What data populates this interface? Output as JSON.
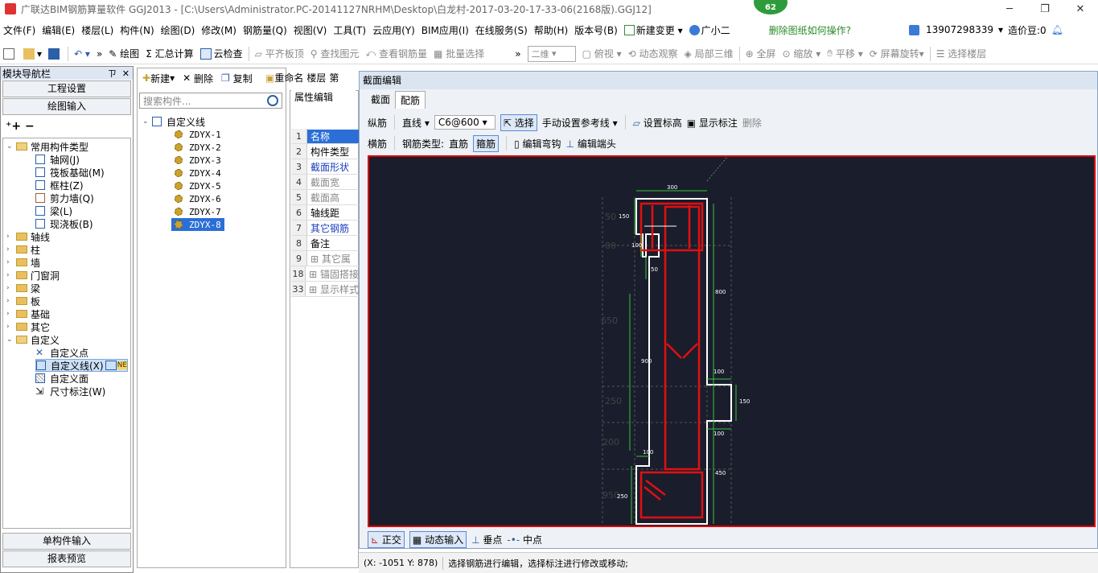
{
  "window": {
    "title": "广联达BIM钢筋算量软件 GGJ2013 - [C:\\Users\\Administrator.PC-20141127NRHM\\Desktop\\白龙村-2017-03-20-17-33-06(2168版).GGJ12]",
    "badge": "62"
  },
  "menu": {
    "items": [
      "文件(F)",
      "编辑(E)",
      "楼层(L)",
      "构件(N)",
      "绘图(D)",
      "修改(M)",
      "钢筋量(Q)",
      "视图(V)",
      "工具(T)",
      "云应用(Y)",
      "BIM应用(I)",
      "在线服务(S)",
      "帮助(H)",
      "版本号(B)"
    ],
    "new_change": "新建变更",
    "xiaoer": "广小二",
    "hint": "删除图纸如何操作?",
    "phone": "13907298339",
    "bean": "造价豆:0"
  },
  "toolbar": {
    "draw": "绘图",
    "sum": "汇总计算",
    "cloud_check": "云检查",
    "flat_top": "平齐板顶",
    "find": "查找图元",
    "view_rebar": "查看钢筋量",
    "batch": "批量选择",
    "view_mode": "二维",
    "top_view": "俯视",
    "dynamic": "动态观察",
    "local3d": "局部三维",
    "fullscreen": "全屏",
    "zoom": "缩放",
    "pan": "平移",
    "rotate": "屏幕旋转",
    "select_floor": "选择楼层"
  },
  "nav": {
    "title": "模块导航栏",
    "pin": "ㄗ",
    "close": "✕",
    "project_settings": "工程设置",
    "draw_input": "绘图输入",
    "tree": {
      "common": "常用构件类型",
      "common_items": [
        "轴网(J)",
        "筏板基础(M)",
        "框柱(Z)",
        "剪力墙(Q)",
        "梁(L)",
        "现浇板(B)"
      ],
      "folders": [
        "轴线",
        "柱",
        "墙",
        "门窗洞",
        "梁",
        "板",
        "基础",
        "其它"
      ],
      "custom": "自定义",
      "custom_items": [
        "自定义点",
        "自定义线(X)",
        "自定义面",
        "尺寸标注(W)"
      ],
      "new_tag": "NE"
    },
    "single_input": "单构件输入",
    "report_preview": "报表预览"
  },
  "components": {
    "new": "新建",
    "delete": "删除",
    "copy": "复制",
    "rename": "重命名",
    "floor": "楼层",
    "more": "第",
    "search_placeholder": "搜索构件...",
    "root": "自定义线",
    "items": [
      "ZDYX-1",
      "ZDYX-2",
      "ZDYX-3",
      "ZDYX-4",
      "ZDYX-5",
      "ZDYX-6",
      "ZDYX-7",
      "ZDYX-8"
    ]
  },
  "props": {
    "tab": "属性编辑",
    "rows": [
      {
        "num": "1",
        "label": "名称"
      },
      {
        "num": "2",
        "label": "构件类型"
      },
      {
        "num": "3",
        "label": "截面形状"
      },
      {
        "num": "4",
        "label": "截面宽"
      },
      {
        "num": "5",
        "label": "截面高"
      },
      {
        "num": "6",
        "label": "轴线距"
      },
      {
        "num": "7",
        "label": "其它钢筋"
      },
      {
        "num": "8",
        "label": "备注"
      },
      {
        "num": "9",
        "label": "其它属"
      },
      {
        "num": "18",
        "label": "锚固搭接"
      },
      {
        "num": "33",
        "label": "显示样式"
      }
    ]
  },
  "section": {
    "title": "截面编辑",
    "tab_section": "截面",
    "tab_rebar": "配筋",
    "long_bar": "纵筋",
    "line": "直线",
    "spec": "C6@600",
    "select": "选择",
    "manual_ref": "手动设置参考线",
    "set_elev": "设置标高",
    "show_label": "显示标注",
    "delete": "删除",
    "trans_bar": "横筋",
    "bar_type": "钢筋类型:",
    "straight": "直筋",
    "stirrup": "箍筋",
    "edit_hook": "编辑弯钩",
    "edit_end": "编辑端头",
    "ortho": "正交",
    "dyn_input": "动态输入",
    "perp": "垂点",
    "mid": "中点"
  },
  "drawing_labels": {
    "top_width": "300",
    "l150": "150",
    "l100": "100",
    "l50": "50",
    "l900": "900",
    "l800": "800",
    "r100a": "100",
    "r150": "150",
    "r100b": "100",
    "r450": "450",
    "l100b": "100",
    "l250": "250",
    "ghost": [
      "50",
      "00",
      "650",
      "250",
      "200",
      "950"
    ]
  },
  "status": {
    "coords": "(X: -1051 Y: 878)",
    "message": "选择钢筋进行编辑，选择标注进行修改或移动;"
  }
}
